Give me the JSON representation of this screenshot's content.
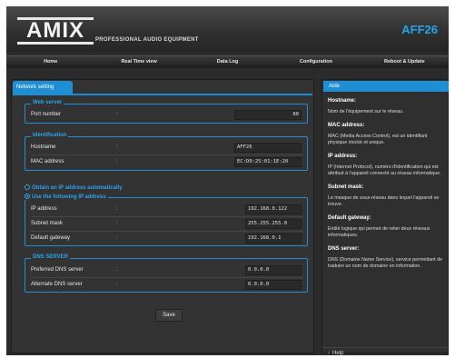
{
  "header": {
    "logo": "AMIX",
    "subtitle": "PROFESSIONAL AUDIO EQUIPMENT",
    "model": "AFF26"
  },
  "nav": {
    "items": [
      "Home",
      "Real Time view",
      "Data Log",
      "Configuration",
      "Reboot & Update"
    ]
  },
  "tab": {
    "label": "Network setting"
  },
  "web_server": {
    "legend": "Web server",
    "port_label": "Port number",
    "port_value": "80"
  },
  "identification": {
    "legend": "Identification",
    "hostname_label": "Hostname",
    "hostname_value": "AFF26",
    "mac_label": "MAC address",
    "mac_value": "EC:D9:25:01:1E:20"
  },
  "ip_mode": {
    "auto_label": "Obtain an IP address automatically",
    "manual_label": "Use the following IP address",
    "ip_label": "IP address",
    "ip_value": "192.168.0.122",
    "mask_label": "Subnet mask",
    "mask_value": "255.255.255.0",
    "gateway_label": "Default gateway",
    "gateway_value": "192.168.0.1"
  },
  "dns": {
    "legend": "DNS SERVER",
    "preferred_label": "Preferred DNS server",
    "preferred_value": "0.0.0.0",
    "alternate_label": "Alternate DNS server",
    "alternate_value": "0.0.0.0"
  },
  "colon": ":",
  "save_label": "Save",
  "help": {
    "title": "Aide",
    "hostname_h": "Hostname:",
    "hostname_p": "Nom de l'équipement sur le réseau.",
    "mac_h": "MAC address:",
    "mac_p": "MAC (Media Access Control), est un identifiant physique stocké et unique.",
    "ip_h": "IP address:",
    "ip_p": "IP (Internet Protocol), numéro d'identification qui est attribué à l'appareil connecté au réseau informatique.",
    "mask_h": "Subnet mask:",
    "mask_p": "Le masque de sous-réseau dans lequel l'appareil se trouve.",
    "gw_h": "Default gateway:",
    "gw_p": "Entité logique qui permet de relier deux réseaux informatiques.",
    "dns_h": "DNS server:",
    "dns_p": "DNS (Domaine Name Service), service permettant de traduire un nom de domaine en information.",
    "footer": "Help",
    "footer_icon": "chevron-right-icon"
  },
  "colors": {
    "accent": "#1e8fd4",
    "panel": "#333333",
    "background": "#2b2b2b"
  }
}
